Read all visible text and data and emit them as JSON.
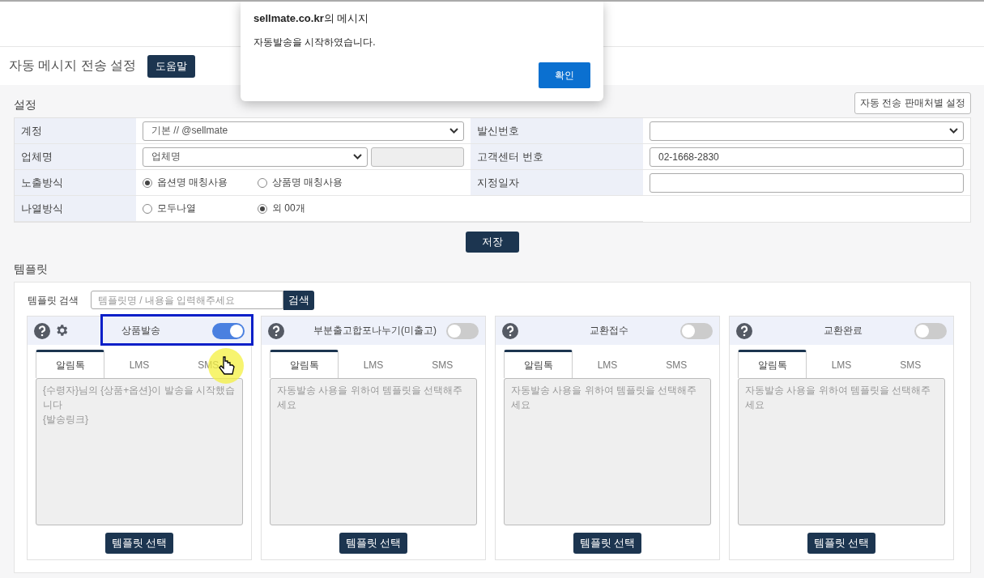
{
  "page_title": "자동 메시지 전송 설정",
  "help_button": "도움말",
  "dialog": {
    "title": "**sellmate.co.kr**의 메시지",
    "message": "자동발송을 시작하였습니다.",
    "ok_button": "확인"
  },
  "settings": {
    "title": "설정",
    "seller_button": "자동 전송 판매처별 설정",
    "left_fields": [
      {
        "kind": "select",
        "label": "계정",
        "value": "기본 // @sellmate"
      },
      {
        "kind": "select_extra",
        "label": "업체명",
        "value": "업체명"
      },
      {
        "kind": "radio",
        "label": "노출방식",
        "options": [
          {
            "label": "옵션명 매칭사용",
            "selected": true
          },
          {
            "label": "상품명 매칭사용",
            "selected": false
          }
        ]
      },
      {
        "kind": "radio",
        "label": "나열방식",
        "options": [
          {
            "label": "모두나열",
            "selected": false
          },
          {
            "label": "외 00개",
            "selected": true
          }
        ]
      }
    ],
    "right_fields": [
      {
        "kind": "select",
        "label": "발신번호"
      },
      {
        "kind": "input",
        "label": "고객센터 번호",
        "value": "02-1668-2830"
      },
      {
        "kind": "input",
        "label": "지정일자"
      }
    ],
    "save_button": "저장"
  },
  "templates": {
    "title": "템플릿",
    "search_label": "템플릿 검색",
    "search_placeholder": "템플릿명 / 내용을 입력해주세요",
    "search_button": "검색",
    "cards": [
      {
        "kind": "with_settings",
        "title": "상품발송",
        "on": true,
        "highlighted": true,
        "tabs": [
          {
            "label": "알림톡",
            "selected": true
          },
          {
            "label": "LMS",
            "selected": false
          },
          {
            "label": "SMS",
            "selected": false
          }
        ],
        "message": "{수령자}님의 {상품+옵션}이 발송을 시작했습니다\n{발송링크}",
        "select_button": "템플릿 선택"
      },
      {
        "kind": "plain",
        "title": "부분출고합포나누기(미출고)",
        "on": false,
        "highlighted": false,
        "tabs": [
          {
            "label": "알림톡",
            "selected": true
          },
          {
            "label": "LMS",
            "selected": false
          },
          {
            "label": "SMS",
            "selected": false
          }
        ],
        "placeholder": "자동발송 사용을 위하여 템플릿을 선택해주세요",
        "select_button": "템플릿 선택"
      },
      {
        "kind": "plain",
        "title": "교환접수",
        "on": false,
        "highlighted": false,
        "tabs": [
          {
            "label": "알림톡",
            "selected": true
          },
          {
            "label": "LMS",
            "selected": false
          },
          {
            "label": "SMS",
            "selected": false
          }
        ],
        "placeholder": "자동발송 사용을 위하여 템플릿을 선택해주세요",
        "select_button": "템플릿 선택"
      },
      {
        "kind": "plain",
        "title": "교환완료",
        "on": false,
        "highlighted": false,
        "tabs": [
          {
            "label": "알림톡",
            "selected": true
          },
          {
            "label": "LMS",
            "selected": false
          },
          {
            "label": "SMS",
            "selected": false
          }
        ],
        "placeholder": "자동발송 사용을 위하여 템플릿을 선택해주세요",
        "select_button": "템플릿 선택"
      }
    ]
  }
}
